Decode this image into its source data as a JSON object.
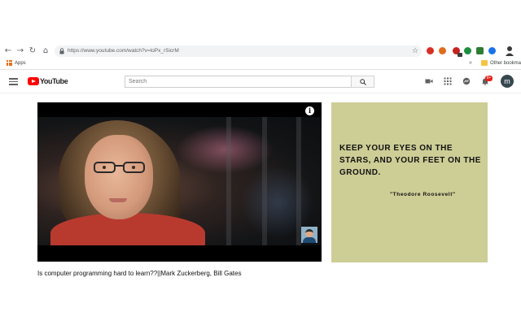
{
  "browser": {
    "url": "https://www.youtube.com/watch?v=loPx_rSicrM",
    "bookmarks_bar": {
      "apps_label": "Apps",
      "overflow": "»",
      "other_bookmarks": "Other bookma"
    },
    "icons": [
      "back-arrow-icon",
      "forward-arrow-icon",
      "reload-icon",
      "home-icon",
      "lock-icon",
      "star-icon"
    ],
    "extension_colors": [
      "#d93025",
      "#e06c1f",
      "#c5221f",
      "#1e8e3e",
      "#2e7d32",
      "#1a73e8"
    ]
  },
  "youtube": {
    "logo_text": "YouTube",
    "search": {
      "placeholder": "Search",
      "value": ""
    },
    "notification_count": "9+",
    "avatar_letter": "m",
    "brand_color": "#ff0000",
    "header_icons": [
      "video-camera-icon",
      "apps-grid-icon",
      "messages-icon",
      "bell-icon"
    ]
  },
  "video": {
    "title": "Is computer programming hard to learn??||Mark Zuckerberg, Bill Gates",
    "info_glyph": "i"
  },
  "quote": {
    "text": "KEEP YOUR EYES ON THE STARS, AND YOUR FEET ON THE GROUND.",
    "author": "\"Theodore Roosevelt\"",
    "background": "#cdcd96"
  }
}
